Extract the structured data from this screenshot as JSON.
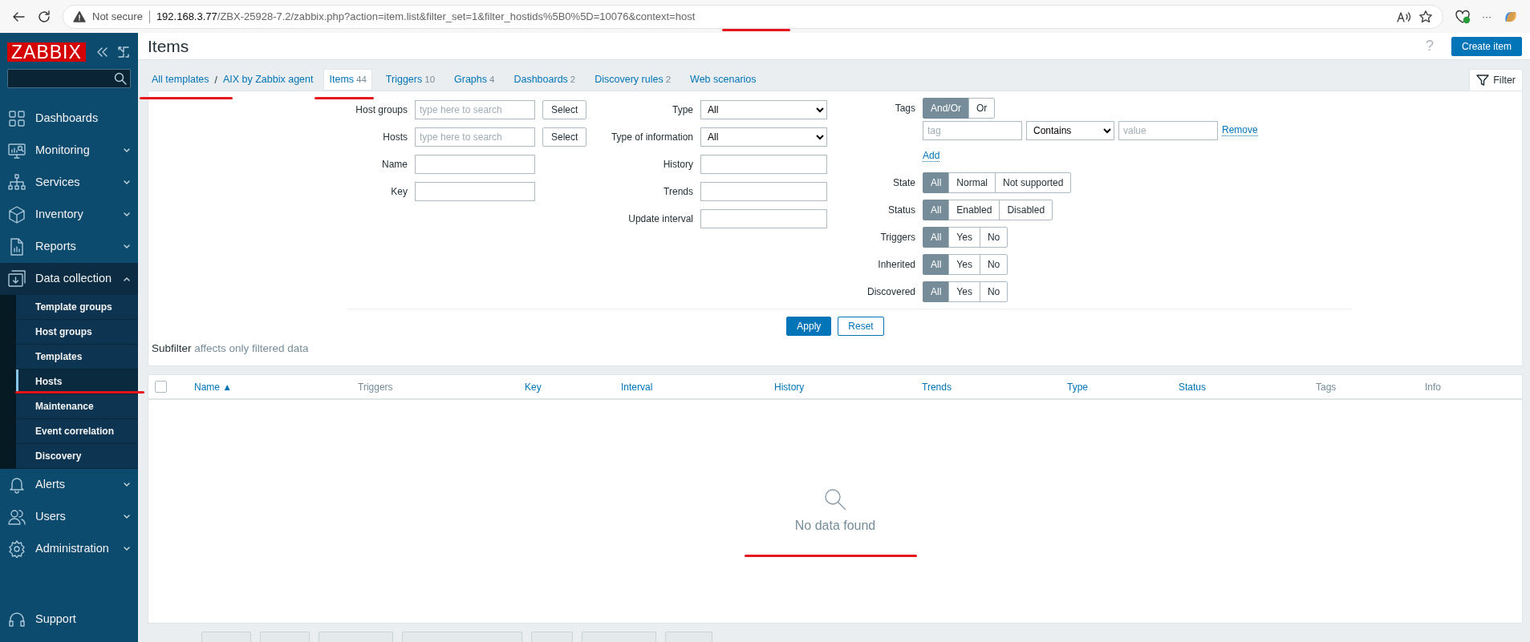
{
  "browser": {
    "security": "Not secure",
    "host": "192.168.3.77",
    "path": "/ZBX-25928-7.2/zabbix.php?action=item.list&filter_set=1&filter_hostids%5B0%5D=10076&context=host",
    "menu": "···"
  },
  "sidebar": {
    "logo": "ZABBIX",
    "menu": [
      {
        "label": "Dashboards",
        "expandable": false,
        "expanded": false
      },
      {
        "label": "Monitoring",
        "expandable": true,
        "expanded": false
      },
      {
        "label": "Services",
        "expandable": true,
        "expanded": false
      },
      {
        "label": "Inventory",
        "expandable": true,
        "expanded": false
      },
      {
        "label": "Reports",
        "expandable": true,
        "expanded": false
      },
      {
        "label": "Data collection",
        "expandable": true,
        "expanded": true,
        "children": [
          {
            "label": "Template groups",
            "selected": false
          },
          {
            "label": "Host groups",
            "selected": false
          },
          {
            "label": "Templates",
            "selected": false
          },
          {
            "label": "Hosts",
            "selected": true
          },
          {
            "label": "Maintenance",
            "selected": false
          },
          {
            "label": "Event correlation",
            "selected": false
          },
          {
            "label": "Discovery",
            "selected": false
          }
        ]
      },
      {
        "label": "Alerts",
        "expandable": true,
        "expanded": false
      },
      {
        "label": "Users",
        "expandable": true,
        "expanded": false
      },
      {
        "label": "Administration",
        "expandable": true,
        "expanded": false
      }
    ],
    "footer": "Support"
  },
  "header": {
    "title": "Items",
    "help": "?",
    "create_button": "Create item"
  },
  "breadcrumbs": [
    "All templates",
    "AIX by Zabbix agent"
  ],
  "breadcrumb_separator": "/",
  "tabs": [
    {
      "label": "Items",
      "count": "44",
      "selected": true
    },
    {
      "label": "Triggers",
      "count": "10",
      "selected": false
    },
    {
      "label": "Graphs",
      "count": "4",
      "selected": false
    },
    {
      "label": "Dashboards",
      "count": "2",
      "selected": false
    },
    {
      "label": "Discovery rules",
      "count": "2",
      "selected": false
    },
    {
      "label": "Web scenarios",
      "selected": false
    }
  ],
  "filter_tab": "Filter",
  "filter": {
    "column_1": [
      {
        "label": "Host groups",
        "kind": "multiselect",
        "placeholder": "type here to search",
        "button": "Select"
      },
      {
        "label": "Hosts",
        "kind": "multiselect",
        "placeholder": "type here to search",
        "button": "Select"
      },
      {
        "label": "Name",
        "kind": "text"
      },
      {
        "label": "Key",
        "kind": "text"
      }
    ],
    "column_2": [
      {
        "label": "Type",
        "kind": "select",
        "value": "All"
      },
      {
        "label": "Type of information",
        "kind": "select",
        "value": "All"
      },
      {
        "label": "History",
        "kind": "text"
      },
      {
        "label": "Trends",
        "kind": "text"
      },
      {
        "label": "Update interval",
        "kind": "text"
      }
    ],
    "tags": {
      "label": "Tags",
      "options": [
        {
          "label": "And/Or",
          "selected": true
        },
        {
          "label": "Or",
          "selected": false
        }
      ],
      "tag_placeholder": "tag",
      "operator": "Contains",
      "value_placeholder": "value",
      "remove": "Remove",
      "add": "Add"
    },
    "segments": [
      {
        "label": "State",
        "options": [
          {
            "label": "All",
            "selected": true
          },
          {
            "label": "Normal",
            "selected": false
          },
          {
            "label": "Not supported",
            "selected": false
          }
        ]
      },
      {
        "label": "Status",
        "options": [
          {
            "label": "All",
            "selected": true
          },
          {
            "label": "Enabled",
            "selected": false
          },
          {
            "label": "Disabled",
            "selected": false
          }
        ]
      },
      {
        "label": "Triggers",
        "options": [
          {
            "label": "All",
            "selected": true
          },
          {
            "label": "Yes",
            "selected": false
          },
          {
            "label": "No",
            "selected": false
          }
        ]
      },
      {
        "label": "Inherited",
        "options": [
          {
            "label": "All",
            "selected": true
          },
          {
            "label": "Yes",
            "selected": false
          },
          {
            "label": "No",
            "selected": false
          }
        ]
      },
      {
        "label": "Discovered",
        "options": [
          {
            "label": "All",
            "selected": true
          },
          {
            "label": "Yes",
            "selected": false
          },
          {
            "label": "No",
            "selected": false
          }
        ]
      }
    ],
    "apply": "Apply",
    "reset": "Reset"
  },
  "subfilter": {
    "label": "Subfilter",
    "hint": "affects only filtered data"
  },
  "table": {
    "select_all_checked": false,
    "columns": [
      {
        "label": "Name",
        "sortable": true,
        "sort_mark": "▲"
      },
      {
        "label": "Triggers",
        "sortable": false
      },
      {
        "label": "Key",
        "sortable": true
      },
      {
        "label": "Interval",
        "sortable": true
      },
      {
        "label": "History",
        "sortable": true
      },
      {
        "label": "Trends",
        "sortable": true
      },
      {
        "label": "Type",
        "sortable": true
      },
      {
        "label": "Status",
        "sortable": true
      },
      {
        "label": "Tags",
        "sortable": false
      },
      {
        "label": "Info",
        "sortable": false
      }
    ],
    "empty_message": "No data found"
  }
}
